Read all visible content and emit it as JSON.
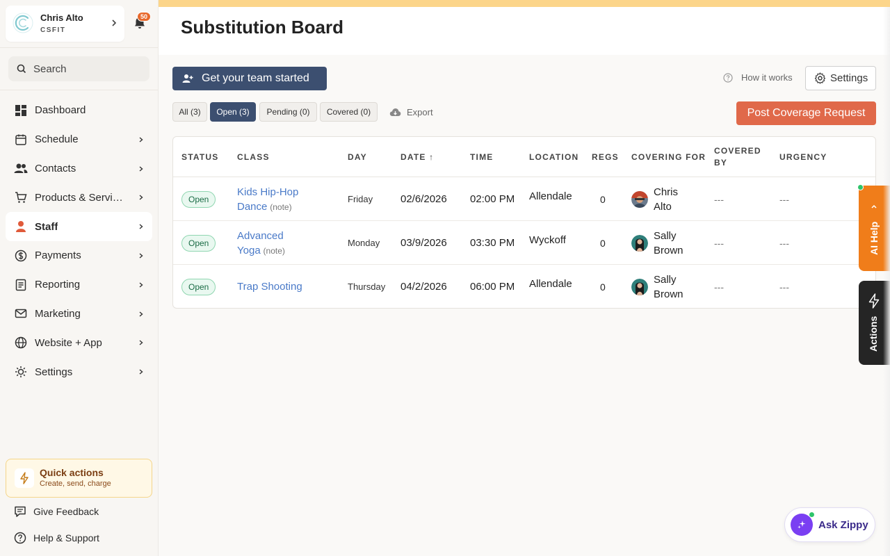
{
  "profile": {
    "name": "Chris Alto",
    "org": "CSFIT",
    "notifications": "50"
  },
  "search": {
    "placeholder": "Search"
  },
  "nav": [
    {
      "label": "Dashboard",
      "icon": "dashboard-icon",
      "chevron": false,
      "active": false
    },
    {
      "label": "Schedule",
      "icon": "calendar-icon",
      "chevron": true,
      "active": false
    },
    {
      "label": "Contacts",
      "icon": "contacts-icon",
      "chevron": true,
      "active": false
    },
    {
      "label": "Products & Services",
      "icon": "cart-icon",
      "chevron": true,
      "active": false
    },
    {
      "label": "Staff",
      "icon": "staff-icon",
      "chevron": true,
      "active": true
    },
    {
      "label": "Payments",
      "icon": "dollar-icon",
      "chevron": true,
      "active": false
    },
    {
      "label": "Reporting",
      "icon": "report-icon",
      "chevron": true,
      "active": false
    },
    {
      "label": "Marketing",
      "icon": "mail-icon",
      "chevron": true,
      "active": false
    },
    {
      "label": "Website + App",
      "icon": "globe-icon",
      "chevron": true,
      "active": false
    },
    {
      "label": "Settings",
      "icon": "sun-gear-icon",
      "chevron": true,
      "active": false
    }
  ],
  "quick_actions": {
    "title": "Quick actions",
    "subtitle": "Create, send, charge"
  },
  "footer": {
    "feedback": "Give Feedback",
    "help": "Help & Support"
  },
  "page": {
    "title": "Substitution Board"
  },
  "toolbar": {
    "team_button": "Get your team started",
    "how_it_works": "How it works",
    "settings": "Settings",
    "export": "Export",
    "post_request": "Post Coverage Request"
  },
  "filters": [
    {
      "label": "All (3)",
      "active": false
    },
    {
      "label": "Open (3)",
      "active": true
    },
    {
      "label": "Pending (0)",
      "active": false
    },
    {
      "label": "Covered (0)",
      "active": false
    }
  ],
  "table": {
    "headers": {
      "status": "STATUS",
      "class": "CLASS",
      "day": "DAY",
      "date": "DATE ↑",
      "time": "TIME",
      "location": "LOCATION",
      "regs": "REGS",
      "covering_for": "COVERING FOR",
      "covered_by": "COVERED BY",
      "urgency": "URGENCY"
    },
    "rows": [
      {
        "status": "Open",
        "class_line1": "Kids Hip-Hop",
        "class_line2": "Dance",
        "note": "(note)",
        "day": "Friday",
        "date": "02/6/2026",
        "time": "02:00 PM",
        "location": "Allendale",
        "regs": "0",
        "covering_first": "Chris",
        "covering_last": "Alto",
        "covered_by": "---",
        "urgency": "---"
      },
      {
        "status": "Open",
        "class_line1": "Advanced",
        "class_line2": "Yoga",
        "note": "(note)",
        "day": "Monday",
        "date": "03/9/2026",
        "time": "03:30 PM",
        "location": "Wyckoff",
        "regs": "0",
        "covering_first": "Sally",
        "covering_last": "Brown",
        "covered_by": "---",
        "urgency": "---"
      },
      {
        "status": "Open",
        "class_line1": "Trap Shooting",
        "class_line2": "",
        "note": "",
        "day": "Thursday",
        "date": "04/2/2026",
        "time": "06:00 PM",
        "location": "Allendale",
        "regs": "0",
        "covering_first": "Sally",
        "covering_last": "Brown",
        "covered_by": "---",
        "urgency": "---"
      }
    ]
  },
  "side_tabs": {
    "ai_help": "AI Help",
    "actions": "Actions"
  },
  "zippy": {
    "label": "Ask Zippy"
  },
  "colors": {
    "accent_orange": "#e0694a",
    "navy": "#3c4f70",
    "ai_orange": "#f07d1a",
    "zippy_purple": "#7a3ff2",
    "open_green": "#1a6b45"
  }
}
